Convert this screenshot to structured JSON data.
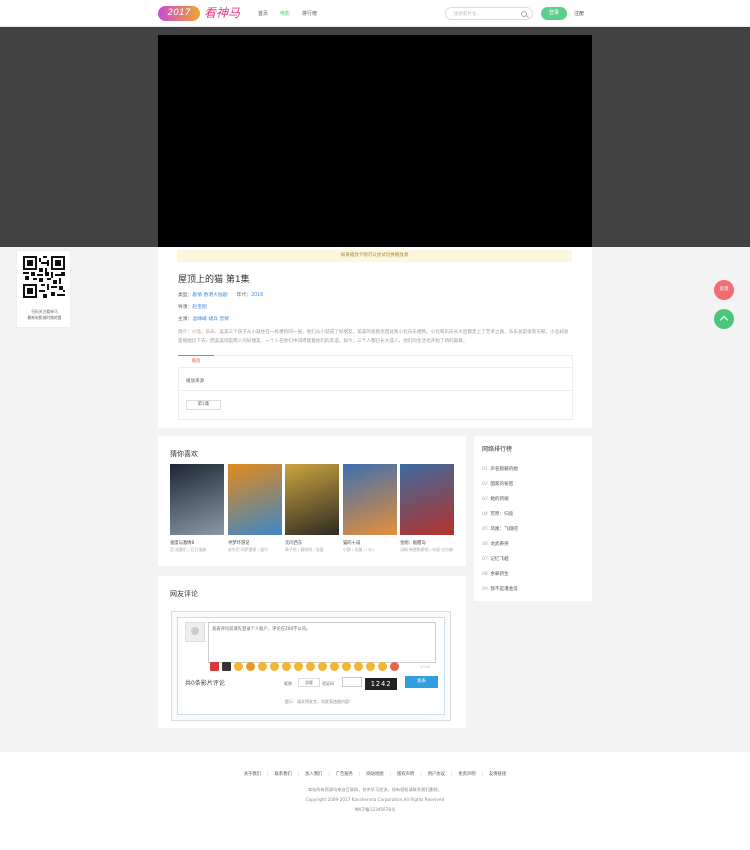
{
  "header": {
    "logo_year": "2017",
    "logo_text": "看神马",
    "nav": [
      "首页",
      "电影",
      "排行榜"
    ],
    "active_nav": "电影",
    "search_placeholder": "搜索影片名...",
    "login_label": "登录",
    "register_label": "注册"
  },
  "player": {
    "notice": "如果播放卡顿可以尝试切换播放源"
  },
  "movie": {
    "title": "屋顶上的猫 第1集",
    "type_label": "类型：",
    "type_value": "剧情  香港大陆剧",
    "year_label": "年代：",
    "year_value": "2016",
    "director_label": "导演：",
    "director_value": "赵宝刚",
    "cast_label": "主演：",
    "cast_value": "温峥嵘  胡兵  曾黎",
    "synopsis": "简介：小北、乐乐、美美三个孩子从小就住在一栋楼的同一层，他们从小就成了好朋友，美美的爸爸也因此和小北乐乐相熟。小北和乐乐长大后都走上了艺术之路，乐乐总是很有天赋，小北却总是被她比下去。而美美则是两人的好朋友，一个人在他们中间周旋着他们的友谊。如今，三个人都已长大成人，他们的生活也开始了新的篇章。",
    "tab_label": "播放",
    "source_label": "播放来源",
    "episode_label": "第1集"
  },
  "qr": {
    "caption_line1": "扫码关注看神马",
    "caption_line2": "最新电影随时随地看"
  },
  "float": {
    "feedback_label": "反馈"
  },
  "recommend": {
    "title": "猜你喜欢",
    "items": [
      {
        "name": "速度与激情8",
        "cast": "范·迪塞尔 / 巨石强森",
        "colors": [
          "#1d2733",
          "#8a99a8"
        ]
      },
      {
        "name": "寻梦环游记",
        "cast": "安东尼·冈萨雷斯 / 盖尔",
        "colors": [
          "#e28a1a",
          "#3d86c8"
        ]
      },
      {
        "name": "无问西东",
        "cast": "章子怡 / 黄晓明 / 张震",
        "colors": [
          "#caa540",
          "#2e2a22"
        ]
      },
      {
        "name": "猫的十诫",
        "cast": "小野 / 佐藤 / 川口",
        "colors": [
          "#3c6fb0",
          "#e78f3a"
        ]
      },
      {
        "name": "金刚：骷髅岛",
        "cast": "汤姆·希德勒斯顿 / 布丽·拉尔森",
        "colors": [
          "#3b6aa0",
          "#b5332b"
        ]
      }
    ]
  },
  "ranking": {
    "title": "网络排行榜",
    "items": [
      {
        "num": "01.",
        "name": "声名狼藉的她"
      },
      {
        "num": "02.",
        "name": "国家的秘密"
      },
      {
        "num": "03.",
        "name": "她的新娘"
      },
      {
        "num": "04.",
        "name": "荒原：归途"
      },
      {
        "num": "05.",
        "name": "凤凰：飞翔吧"
      },
      {
        "num": "06.",
        "name": "龙武奇侠"
      },
      {
        "num": "07.",
        "name": "记忆飞越"
      },
      {
        "num": "08.",
        "name": "余罪新生"
      },
      {
        "num": "09.",
        "name": "我不是潘金莲"
      }
    ]
  },
  "comments": {
    "title": "网友评论",
    "textarea_value": "发表评论前请先登录个人账户，评论在200字以内。",
    "char_count": "0/200",
    "count_text": "共0条影片评论",
    "user_label": "昵称",
    "user_value": "游客",
    "code_label": "验证码",
    "captcha": "1242",
    "submit_label": "发表",
    "tip": "提示：请文明发言，勿发表违规内容！"
  },
  "footer": {
    "links": [
      "关于我们",
      "联系我们",
      "加入我们",
      "广告服务",
      "网站地图",
      "版权声明",
      "用户协议",
      "免责声明",
      "友情链接"
    ],
    "line1": "本站所有资源均来自互联网，仅供学习交流，如有侵权请联系我们删除。",
    "line2": "Copyright 2009-2017 Kanshenma Corporation,All Rights Reserved",
    "line3": "粤ICP备12345678号"
  }
}
